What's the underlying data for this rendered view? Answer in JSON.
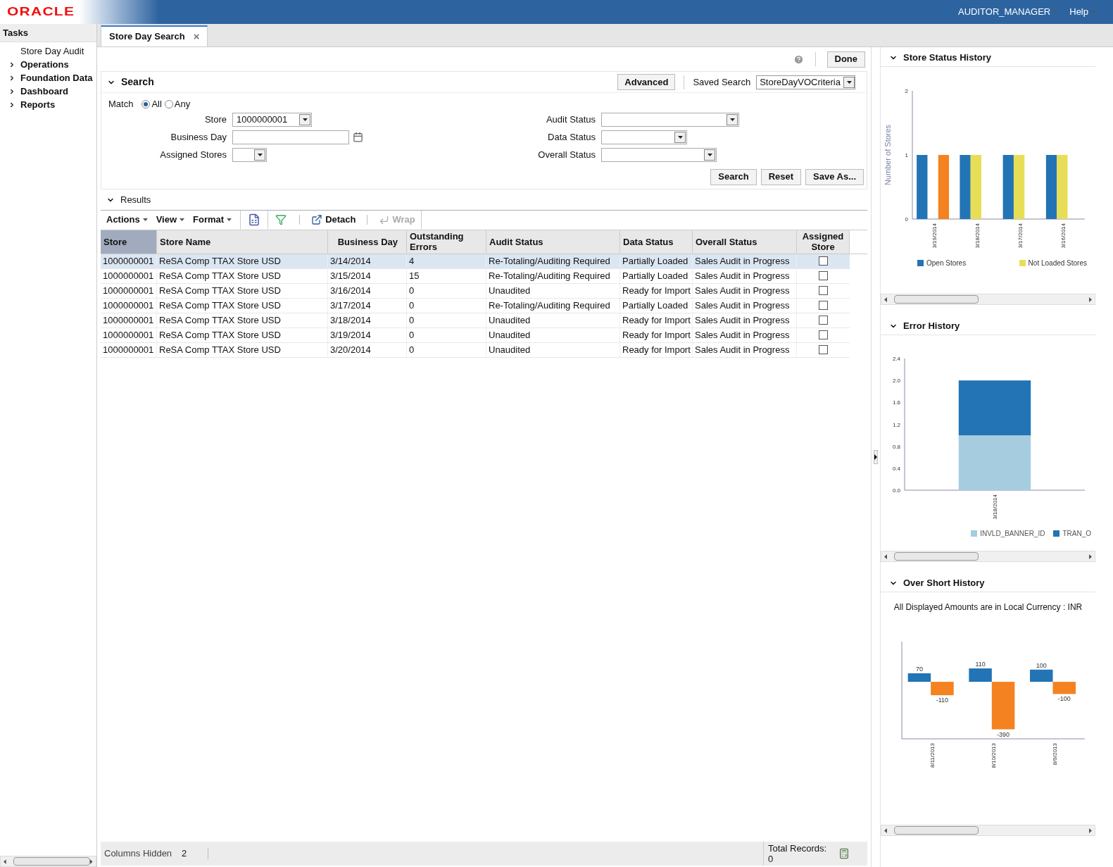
{
  "header": {
    "logo": "ORACLE",
    "user_menu": "AUDITOR_MANAGER",
    "help_menu": "Help"
  },
  "sidebar": {
    "title": "Tasks",
    "items": [
      {
        "label": "Store Day Audit",
        "expandable": false
      },
      {
        "label": "Operations",
        "expandable": true
      },
      {
        "label": "Foundation Data",
        "expandable": true
      },
      {
        "label": "Dashboard",
        "expandable": true
      },
      {
        "label": "Reports",
        "expandable": true
      }
    ]
  },
  "tabs": [
    {
      "label": "Store Day Search",
      "selected": true,
      "close": "×"
    }
  ],
  "done_button": "Done",
  "search": {
    "title": "Search",
    "advanced": "Advanced",
    "saved_search_label": "Saved Search",
    "saved_search": "StoreDayVOCriteria",
    "match_label": "Match",
    "match_options": [
      {
        "label": "All",
        "selected": true
      },
      {
        "label": "Any",
        "selected": false
      }
    ],
    "left_fields": [
      {
        "label": "Store",
        "value": "1000000001",
        "kind": "select"
      },
      {
        "label": "Business Day",
        "kind": "date"
      },
      {
        "label": "Assigned Stores",
        "kind": "small-select"
      }
    ],
    "right_fields": [
      {
        "label": "Audit Status",
        "kind": "select-wide"
      },
      {
        "label": "Data Status",
        "kind": "select-mid"
      },
      {
        "label": "Overall Status",
        "kind": "select-large"
      }
    ],
    "buttons": [
      "Search",
      "Reset",
      "Save As..."
    ]
  },
  "results": {
    "title": "Results",
    "menus": [
      "Actions",
      "View",
      "Format"
    ],
    "detach": "Detach",
    "wrap": {
      "label": "Wrap",
      "disabled": true
    },
    "columns": [
      {
        "label": "Store",
        "sorted": true
      },
      {
        "label": "Store Name",
        "sorted": false
      },
      {
        "label": "Business Day",
        "sorted": false
      },
      {
        "label": "Outstanding Errors",
        "sorted": false
      },
      {
        "label": "Audit Status",
        "sorted": false
      },
      {
        "label": "Data Status",
        "sorted": false
      },
      {
        "label": "Overall Status",
        "sorted": false
      },
      {
        "label": "Assigned Store",
        "sorted": false
      }
    ],
    "rows": [
      {
        "selected": true,
        "cells": [
          "1000000001",
          "ReSA Comp TTAX Store USD",
          "3/14/2014",
          "4",
          "Re-Totaling/Auditing Required",
          "Partially Loaded",
          "Sales Audit in Progress"
        ],
        "assigned": false
      },
      {
        "selected": false,
        "cells": [
          "1000000001",
          "ReSA Comp TTAX Store USD",
          "3/15/2014",
          "15",
          "Re-Totaling/Auditing Required",
          "Partially Loaded",
          "Sales Audit in Progress"
        ],
        "assigned": false
      },
      {
        "selected": false,
        "cells": [
          "1000000001",
          "ReSA Comp TTAX Store USD",
          "3/16/2014",
          "0",
          "Unaudited",
          "Ready for Import",
          "Sales Audit in Progress"
        ],
        "assigned": false
      },
      {
        "selected": false,
        "cells": [
          "1000000001",
          "ReSA Comp TTAX Store USD",
          "3/17/2014",
          "0",
          "Re-Totaling/Auditing Required",
          "Partially Loaded",
          "Sales Audit in Progress"
        ],
        "assigned": false
      },
      {
        "selected": false,
        "cells": [
          "1000000001",
          "ReSA Comp TTAX Store USD",
          "3/18/2014",
          "0",
          "Unaudited",
          "Ready for Import",
          "Sales Audit in Progress"
        ],
        "assigned": false
      },
      {
        "selected": false,
        "cells": [
          "1000000001",
          "ReSA Comp TTAX Store USD",
          "3/19/2014",
          "0",
          "Unaudited",
          "Ready for Import",
          "Sales Audit in Progress"
        ],
        "assigned": false
      },
      {
        "selected": false,
        "cells": [
          "1000000001",
          "ReSA Comp TTAX Store USD",
          "3/20/2014",
          "0",
          "Unaudited",
          "Ready for Import",
          "Sales Audit in Progress"
        ],
        "assigned": false
      }
    ],
    "columns_hidden_label": "Columns Hidden",
    "columns_hidden": "2",
    "total_records_label": "Total Records:",
    "total_records": "0"
  },
  "panels": [
    {
      "title": "Store Status History",
      "chart_data": {
        "type": "bar",
        "ylabel": "Number of Stores",
        "categories": [
          "3/19/2014",
          "3/18/2014",
          "3/17/2014",
          "3/16/2014"
        ],
        "ylim": [
          0,
          2
        ],
        "yticks": [
          0,
          1,
          2
        ],
        "series": [
          {
            "name": "Open Stores",
            "color": "#2274b5",
            "values": [
              1,
              1,
              1,
              1
            ]
          },
          {
            "name": "Not Loaded Stores",
            "color": "#e8de55",
            "values": [
              null,
              1,
              1,
              1
            ]
          },
          {
            "color": "#f58220",
            "values": [
              1,
              null,
              null,
              null
            ]
          }
        ]
      }
    },
    {
      "title": "Error History",
      "chart_data": {
        "type": "bar",
        "stacked": true,
        "categories": [
          "3/18/2014"
        ],
        "ylim": [
          0,
          2.4
        ],
        "yticks": [
          {
            "value": 0,
            "label": "0.0"
          },
          {
            "value": 0.4,
            "label": "0.4"
          },
          {
            "value": 0.8,
            "label": "0.8"
          },
          {
            "value": 1.2,
            "label": "1.2"
          },
          {
            "value": 1.6,
            "label": "1.6"
          },
          {
            "value": 2,
            "label": "2.0"
          },
          {
            "value": 2.4,
            "label": "2.4"
          }
        ],
        "series": [
          {
            "name": "INVLD_BANNER_ID",
            "color": "#a6cce0",
            "values": [
              1
            ]
          },
          {
            "name": "TRAN_O",
            "color": "#2274b5",
            "values": [
              1
            ]
          }
        ]
      }
    },
    {
      "title": "Over Short History",
      "note": "All Displayed Amounts are in Local Currency : INR",
      "chart_data": {
        "type": "bar",
        "categories": [
          "8/11/2013",
          "8/10/2013",
          "8/9/2013"
        ],
        "data_labels": true,
        "series": [
          {
            "color": "#2274b5",
            "values": [
              70,
              110,
              100
            ]
          },
          {
            "color": "#f58220",
            "values": [
              -110,
              -390,
              -100
            ]
          }
        ]
      }
    }
  ]
}
